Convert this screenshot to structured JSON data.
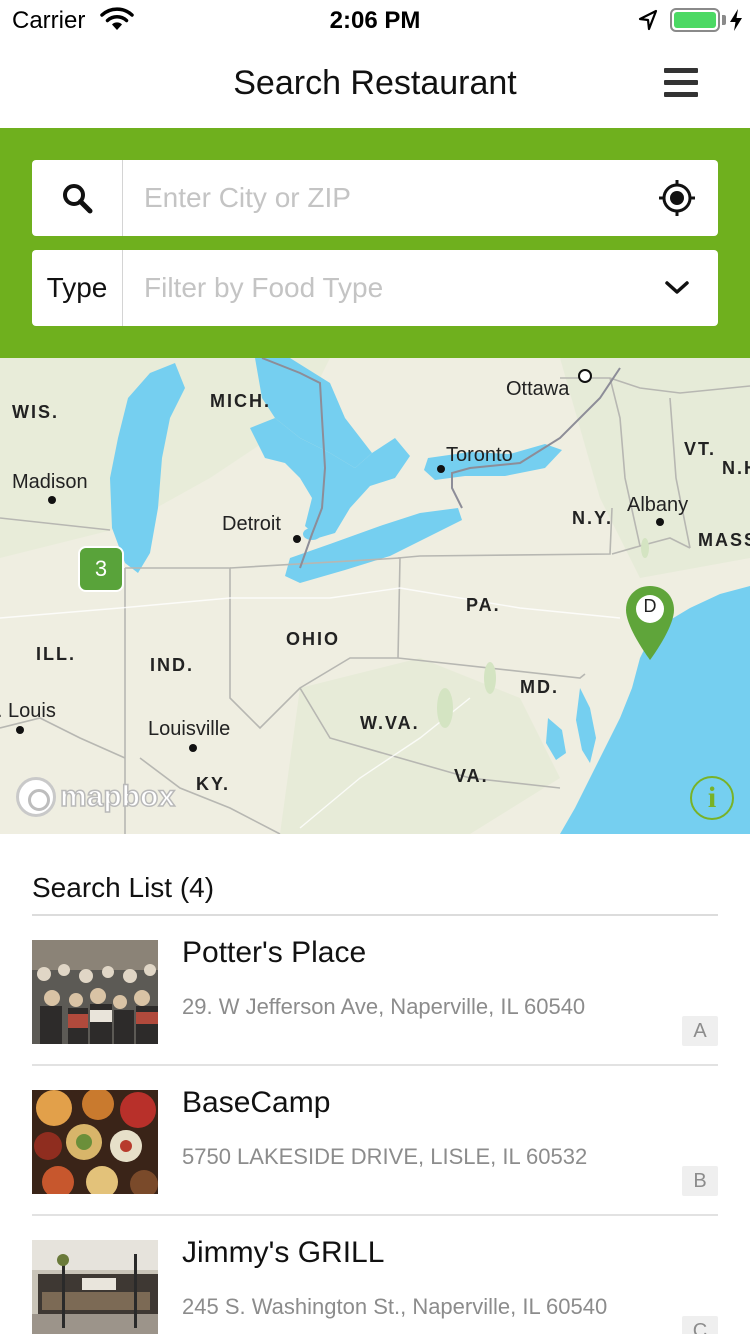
{
  "status_bar": {
    "carrier": "Carrier",
    "time": "2:06 PM",
    "battery_color": "#4cd964"
  },
  "nav": {
    "title": "Search Restaurant",
    "menu_icon": "hamburger-menu-icon"
  },
  "search": {
    "panel_color": "#6fb01e",
    "city_icon": "search-icon",
    "city_placeholder": "Enter City or ZIP",
    "location_icon": "crosshair-location-icon",
    "type_label": "Type",
    "type_placeholder": "Filter by Food Type",
    "type_dropdown_icon": "chevron-down-icon"
  },
  "map": {
    "labels": {
      "wis": "WIS.",
      "mich": "MICH.",
      "ottawa": "Ottawa",
      "toronto": "Toronto",
      "vt": "VT.",
      "nh": "N.H",
      "madison": "Madison",
      "detroit": "Detroit",
      "ny": "N.Y.",
      "albany": "Albany",
      "mass": "MASS",
      "pa": "PA.",
      "ill": "ILL.",
      "ohio": "OHIO",
      "ind": "IND.",
      "md": "MD.",
      "st_louis": "St. Louis",
      "louisville": "Louisville",
      "wva": "W.VA.",
      "ky": "KY.",
      "va": "VA."
    },
    "cluster_count": "3",
    "pin_letter": "D",
    "pin_color": "#5fa53a",
    "attribution": "mapbox",
    "info_icon": "info-icon"
  },
  "list": {
    "header": "Search List (4)",
    "items": [
      {
        "name": "Potter's Place",
        "address": "29. W Jefferson Ave, Naperville, IL 60540",
        "badge": "A",
        "thumb": "crowd-photo"
      },
      {
        "name": "BaseCamp",
        "address": "5750 LAKESIDE DRIVE, LISLE, IL 60532",
        "badge": "B",
        "thumb": "food-dishes-photo"
      },
      {
        "name": "Jimmy's GRILL",
        "address": "245 S. Washington St., Naperville, IL 60540",
        "badge": "C",
        "thumb": "storefront-photo"
      }
    ]
  }
}
